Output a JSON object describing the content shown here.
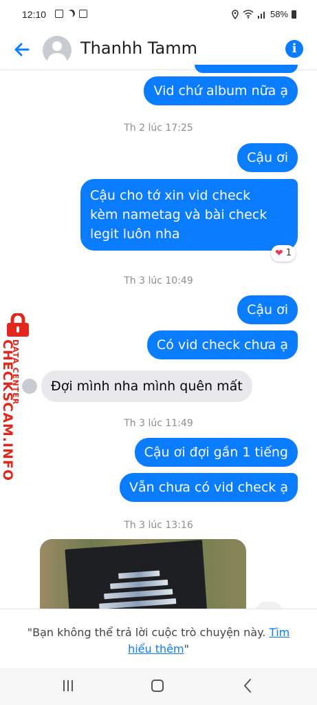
{
  "status_bar": {
    "time": "12:10",
    "battery": "58%"
  },
  "header": {
    "contact_name": "Thanhh Tamm"
  },
  "messages": [
    {
      "text": "Vid chứ album nữa ạ"
    },
    {
      "text": "Th 2 lúc 17:25"
    },
    {
      "text": "Cậu ơi"
    },
    {
      "text": "Cậu cho tớ xin vid check\nkèm nametag và bài check\nlegit luôn nha"
    },
    {
      "text": "1"
    },
    {
      "text": "Th 3 lúc 10:49"
    },
    {
      "text": "Cậu ơi"
    },
    {
      "text": "Có vid check chưa ạ"
    },
    {
      "text": "Đợi mình nha mình quên mất"
    },
    {
      "text": "Th 3 lúc 11:49"
    },
    {
      "text": "Cậu ơi đợi gần 1 tiếng"
    },
    {
      "text": "Vẫn chưa có vid check ạ"
    },
    {
      "text": "Th 3 lúc 13:16"
    }
  ],
  "footer": {
    "notice": "\"Bạn không thể trả lời cuộc trò chuyện này.",
    "link": "Tìm hiểu thêm",
    "close_quote": "\""
  },
  "watermark": {
    "small": "DATA CENTER",
    "main": "CHECKSCAM.INFO"
  },
  "colors": {
    "accent": "#0a7cff",
    "incoming": "#e9e9eb",
    "watermark": "#e1261c"
  },
  "icons": [
    "back-arrow-icon",
    "info-icon",
    "heart-icon",
    "lock-icon",
    "nav-recent-icon",
    "nav-home-icon",
    "nav-back-icon"
  ]
}
